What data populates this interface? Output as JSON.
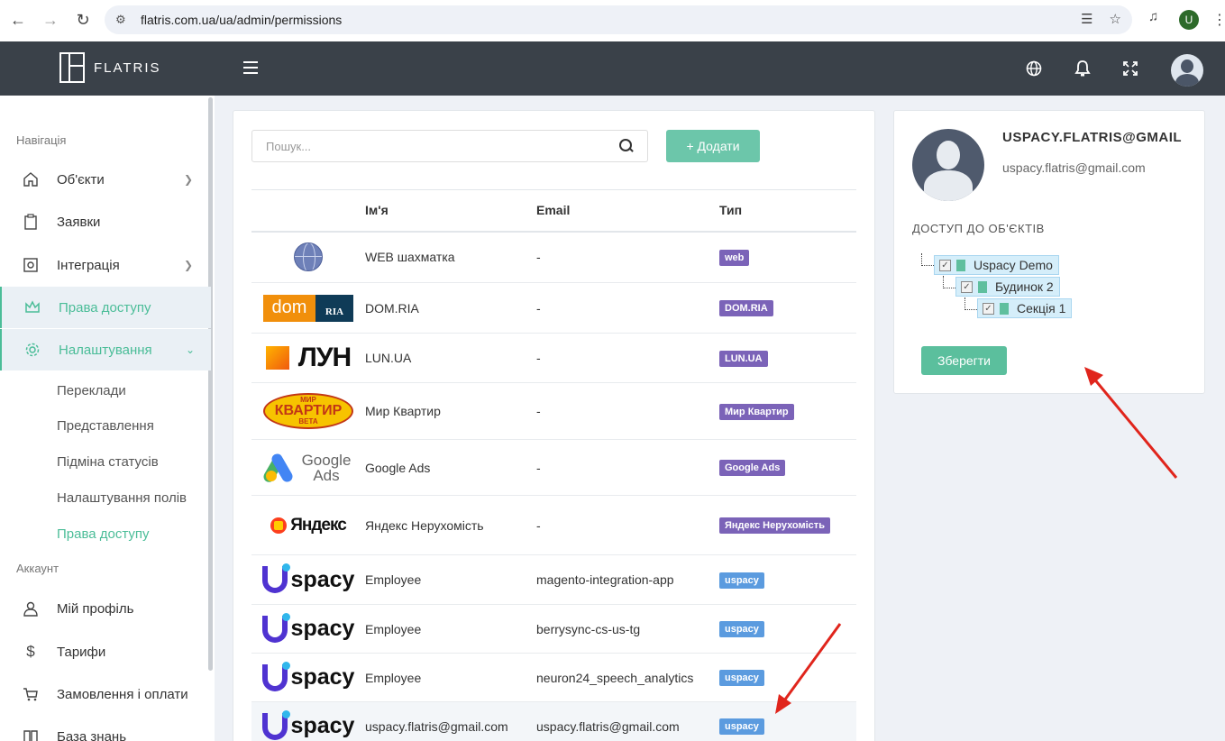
{
  "browser": {
    "url": "flatris.com.ua/ua/admin/permissions",
    "profile_initial": "U"
  },
  "app": {
    "brand": "FLATRIS"
  },
  "sidebar": {
    "section_nav": "Навігація",
    "section_account": "Аккаунт",
    "items": [
      {
        "label": "Об'єкти"
      },
      {
        "label": "Заявки"
      },
      {
        "label": "Інтеграція"
      },
      {
        "label": "Права доступу"
      },
      {
        "label": "Налаштування"
      }
    ],
    "sub_items": [
      {
        "label": "Переклади"
      },
      {
        "label": "Представлення"
      },
      {
        "label": "Підміна статусів"
      },
      {
        "label": "Налаштування полів"
      },
      {
        "label": "Права доступу"
      }
    ],
    "account_items": [
      {
        "label": "Мій профіль"
      },
      {
        "label": "Тарифи"
      },
      {
        "label": "Замовлення і оплати"
      },
      {
        "label": "База знань"
      }
    ]
  },
  "main": {
    "search_placeholder": "Пошук...",
    "add_label": "+ Додати",
    "columns": {
      "name": "Ім'я",
      "email": "Email",
      "type": "Тип"
    },
    "rows": [
      {
        "logo": "globe",
        "name": "WEB шахматка",
        "email": "-",
        "type": "web"
      },
      {
        "logo": "domria",
        "name": "DOM.RIA",
        "email": "-",
        "type": "DOM.RIA"
      },
      {
        "logo": "lun",
        "name": "LUN.UA",
        "email": "-",
        "type": "LUN.UA"
      },
      {
        "logo": "mirkvartir",
        "name": "Мир Квартир",
        "email": "-",
        "type": "Мир Квартир"
      },
      {
        "logo": "googleads",
        "name": "Google Ads",
        "email": "-",
        "type": "Google Ads"
      },
      {
        "logo": "yandex",
        "name": "Яндекс Нерухомість",
        "email": "-",
        "type": "Яндекс Нерухомість"
      },
      {
        "logo": "uspacy",
        "name": "Employee",
        "email": "magento-integration-app",
        "type": "uspacy"
      },
      {
        "logo": "uspacy",
        "name": "Employee",
        "email": "berrysync-cs-us-tg",
        "type": "uspacy"
      },
      {
        "logo": "uspacy",
        "name": "Employee",
        "email": "neuron24_speech_analytics",
        "type": "uspacy"
      },
      {
        "logo": "uspacy",
        "name": "uspacy.flatris@gmail.com",
        "email": "uspacy.flatris@gmail.com",
        "type": "uspacy"
      }
    ],
    "logos": {
      "domria_left": "dom",
      "domria_right": "RIA",
      "lun": "ЛУН",
      "mir_top": "МИР",
      "mir_main": "КВАРТИР",
      "mir_sub": "BETA",
      "gads_1": "Google",
      "gads_2": "Ads",
      "yandex": "Яндекс",
      "uspacy": "spacy"
    }
  },
  "panel": {
    "name": "USPACY.FLATRIS@GMAIL",
    "email": "uspacy.flatris@gmail.com",
    "access_title": "ДОСТУП ДО ОБ'ЄКТІВ",
    "tree": [
      {
        "label": "Uspacy Demo"
      },
      {
        "label": "Будинок 2"
      },
      {
        "label": "Секція 1"
      }
    ],
    "save_label": "Зберегти"
  },
  "colors": {
    "accent": "#4bbd98",
    "badge_purple": "#7b63b8",
    "badge_blue": "#5b9bdf",
    "header_bg": "#3a4149",
    "arrow": "#e0251c"
  }
}
